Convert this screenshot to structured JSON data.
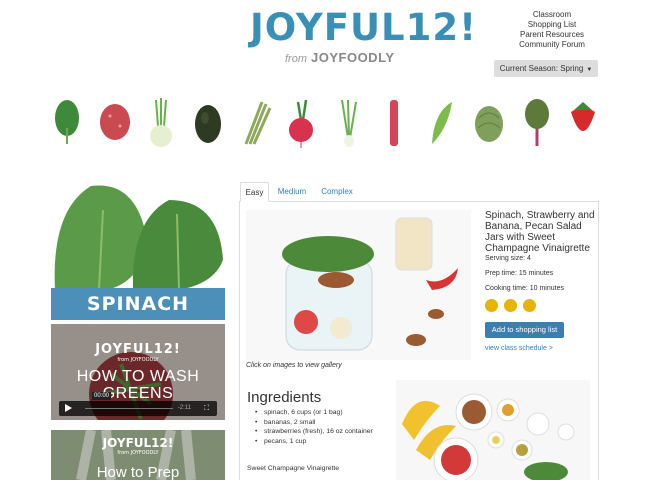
{
  "header": {
    "logo_main": "JOYFUL12!",
    "logo_from": "from",
    "logo_brand": "JOYFOODLY",
    "nav": [
      "Classroom",
      "Shopping List",
      "Parent Resources",
      "Community Forum"
    ],
    "season": "Current Season: Spring"
  },
  "veg_strip": [
    "spinach",
    "red-potato",
    "fennel",
    "avocado",
    "asparagus",
    "radish",
    "green-onion",
    "rhubarb",
    "snap-pea",
    "artichoke",
    "chard",
    "strawberry"
  ],
  "left": {
    "hero_label": "SPINACH",
    "video1": {
      "brand": "JOYFUL12!",
      "brand_sub": "from JOYFOODLY",
      "title": "HOW TO WASH GREENS",
      "time": "00:00",
      "duration": "-2:11"
    },
    "video2": {
      "brand": "JOYFUL12!",
      "brand_sub": "from JOYFOODLY",
      "title": "How to Prep"
    }
  },
  "tabs": [
    "Easy",
    "Medium",
    "Complex"
  ],
  "recipe": {
    "title": "Spinach, Strawberry and Banana, Pecan Salad Jars with Sweet Champagne Vinaigrette",
    "serving": "Serving size: 4",
    "prep": "Prep time: 15 minutes",
    "cooking": "Cooking time: 10 minutes",
    "add_button": "Add to shopping list",
    "schedule_link": "view class schedule >",
    "caption": "Click on images to view gallery"
  },
  "ingredients": {
    "heading": "Ingredients",
    "items": [
      "spinach, 6 cups (or 1 bag)",
      "bananas, 2 small",
      "strawberries (fresh), 16 oz container",
      "pecans, 1 cup"
    ],
    "sub_heading": "Sweet Champagne Vinaigrette"
  },
  "colors": {
    "brand_blue": "#3a8fb7",
    "button_blue": "#3a7fb0",
    "level_gold": "#e8b400"
  }
}
